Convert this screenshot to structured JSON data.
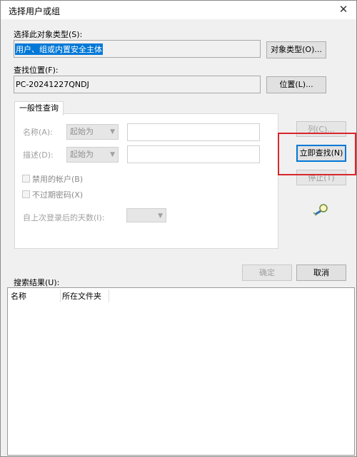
{
  "window": {
    "title": "选择用户或组",
    "close_glyph": "✕"
  },
  "object_type": {
    "label": "选择此对象类型(S):",
    "value": "用户、组或内置安全主体",
    "button": "对象类型(O)..."
  },
  "location": {
    "label": "查找位置(F):",
    "value": "PC-20241227QNDJ",
    "button": "位置(L)..."
  },
  "tab": {
    "label": "一般性查询"
  },
  "query": {
    "name_label": "名称(A):",
    "name_mode": "起始为",
    "desc_label": "描述(D):",
    "desc_mode": "起始为",
    "disabled_accounts": "禁用的帐户(B)",
    "non_expiring": "不过期密码(X)",
    "days_label": "自上次登录后的天数(I):"
  },
  "side_buttons": {
    "columns": "列(C)...",
    "find_now": "立即查找(N)",
    "stop": "停止(T)"
  },
  "footer": {
    "ok": "确定",
    "cancel": "取消"
  },
  "results": {
    "label": "搜索结果(U):",
    "columns": [
      "名称",
      "所在文件夹"
    ]
  },
  "colors": {
    "highlight_border": "#d9262c",
    "selection": "#0078d7"
  }
}
